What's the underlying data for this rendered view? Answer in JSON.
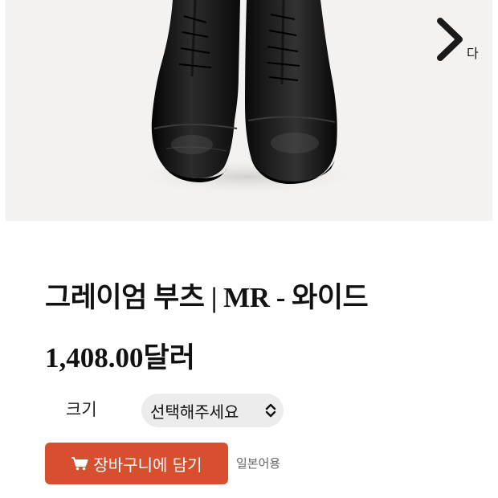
{
  "product": {
    "title": "그레이엄 부츠 | MR - 와이드",
    "price": "1,408.00달러"
  },
  "gallery": {
    "next_label": "다",
    "next_icon": "chevron-right-icon"
  },
  "options": {
    "size_label": "크기",
    "size_select_value": "선택해주세요"
  },
  "actions": {
    "cart_icon": "cart-icon",
    "add_to_cart_label": "장바구니에 담기",
    "language_link": "일본어용"
  },
  "colors": {
    "accent": "#d84f30",
    "select_bg": "#ececec",
    "photo_bg": "#f3f2f0"
  }
}
